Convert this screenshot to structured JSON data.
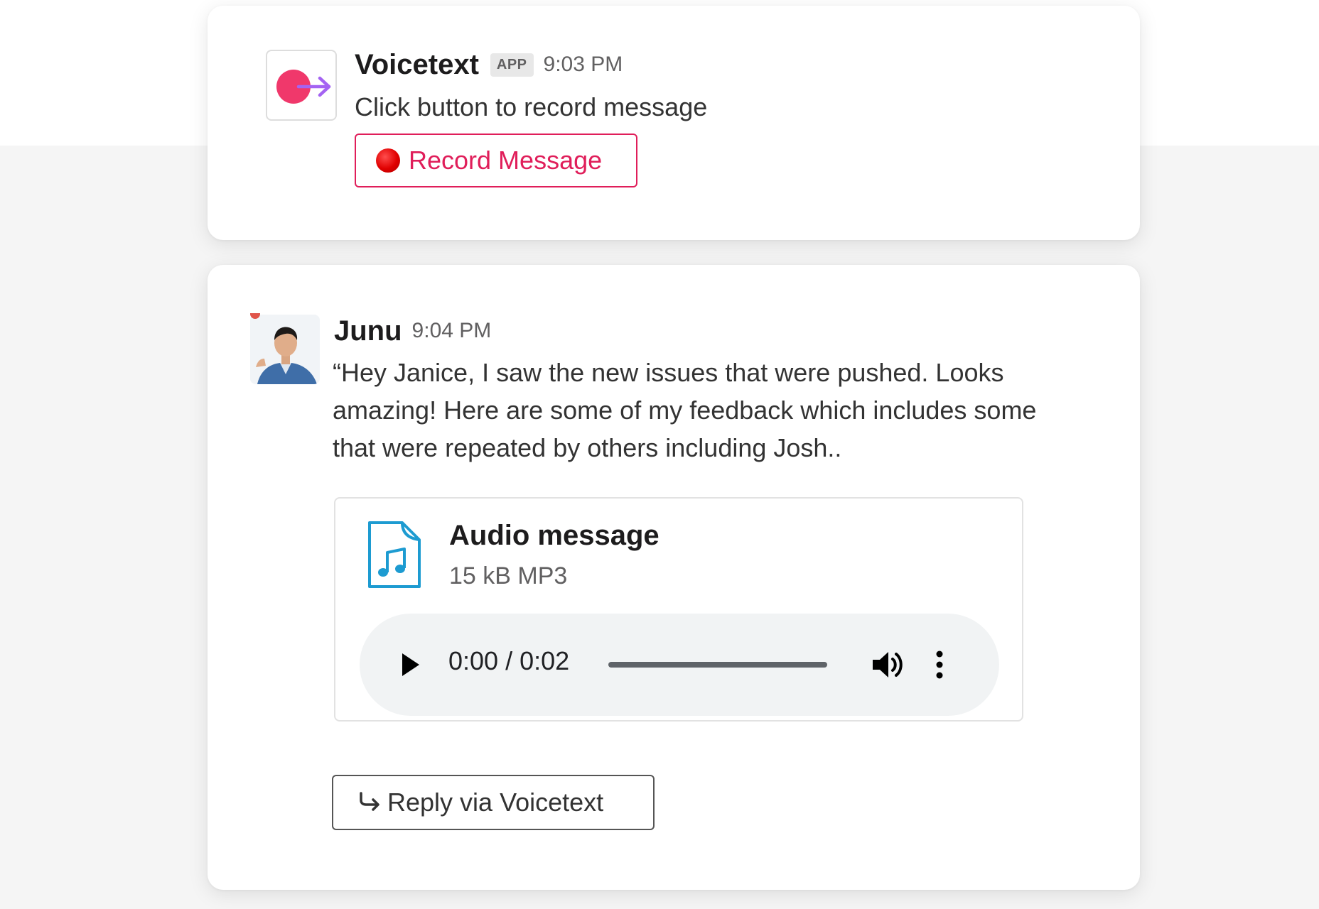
{
  "colors": {
    "record_accent": "#e01e5a",
    "record_dot": "#e00000",
    "app_icon_dot": "#f0386b",
    "app_icon_arrow": "#a463f2",
    "file_icon": "#1d9bd1"
  },
  "voicetext_message": {
    "icon": "voicetext-app-icon",
    "sender": "Voicetext",
    "badge": "APP",
    "time": "9:03 PM",
    "text": "Click button to record message",
    "record_button": {
      "icon": "record-dot-icon",
      "label": "Record Message"
    }
  },
  "junu_message": {
    "avatar": "avatar",
    "sender": "Junu",
    "time": "9:04 PM",
    "text": "“Hey Janice, I saw the new issues that were pushed. Looks amazing! Here are some of my feedback which includes some that were repeated by others including Josh..",
    "attachment": {
      "icon": "audio-file-icon",
      "title": "Audio message",
      "meta": "15 kB MP3",
      "player": {
        "play_icon": "play-icon",
        "time": "0:00 / 0:02",
        "progress_fraction": 0,
        "volume_icon": "volume-icon",
        "more_icon": "more-vertical-icon"
      }
    },
    "reply_button": {
      "icon": "reply-arrow-icon",
      "label": "Reply via Voicetext"
    }
  }
}
